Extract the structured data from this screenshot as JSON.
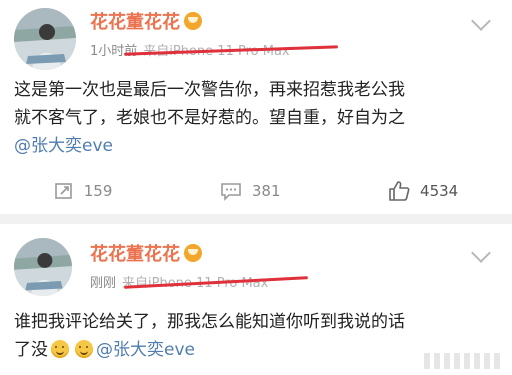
{
  "posts": [
    {
      "username": "花花董花花",
      "time": "1小时前",
      "source": "来自iPhone 11 Pro Max",
      "text_lines": [
        "这是第一次也是最后一次警告你，再来招惹我老公我",
        "就不客气了，老娘也不是好惹的。望自重，好自为之"
      ],
      "mention": "@张大奕eve",
      "repost_count": "159",
      "comment_count": "381",
      "like_count": "4534"
    },
    {
      "username": "花花董花花",
      "time": "刚刚",
      "source": "来自iPhone 11 Pro Max",
      "text_lines": [
        "谁把我评论给关了，那我怎么能知道你听到我说的话",
        "了没"
      ],
      "mention": "@张大奕eve"
    }
  ],
  "colors": {
    "username": "#eb7350",
    "mention": "#507daf",
    "redacted_line": "#e0303a",
    "muted": "#8a8a8a"
  },
  "icons": {
    "verified": "vip-crown-icon",
    "menu": "chevron-down-icon",
    "repost": "repost-icon",
    "comment": "comment-icon",
    "like": "thumbs-up-icon"
  }
}
